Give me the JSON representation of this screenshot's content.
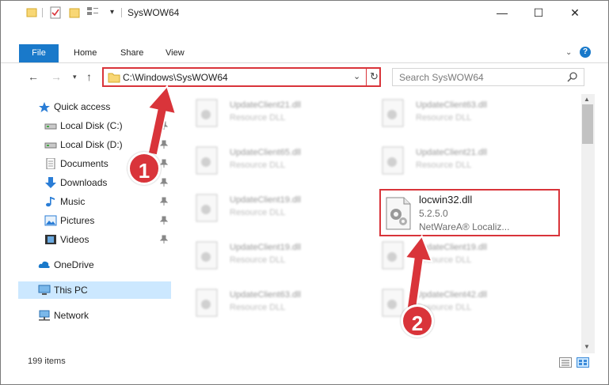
{
  "window": {
    "title": "SysWOW64"
  },
  "controls": {
    "minimize": "—",
    "maximize": "☐",
    "close": "✕"
  },
  "ribbon": {
    "file": "File",
    "home": "Home",
    "share": "Share",
    "view": "View",
    "help": "?"
  },
  "address": {
    "path": "C:\\Windows\\SysWOW64"
  },
  "search": {
    "placeholder": "Search SysWOW64"
  },
  "nav": {
    "quick_access": "Quick access",
    "local_c": "Local Disk (C:)",
    "local_d": "Local Disk (D:)",
    "documents": "Documents",
    "downloads": "Downloads",
    "music": "Music",
    "pictures": "Pictures",
    "videos": "Videos",
    "onedrive": "OneDrive",
    "this_pc": "This PC",
    "network": "Network"
  },
  "files": [
    {
      "name": "UpdateClient21.dll",
      "type": "Resource DLL"
    },
    {
      "name": "UpdateClient63.dll",
      "type": "Resource DLL"
    },
    {
      "name": "UpdateClient65.dll",
      "type": "Resource DLL"
    },
    {
      "name": "UpdateClient21.dll",
      "type": "Resource DLL"
    },
    {
      "name": "UpdateClient19.dll",
      "type": "Resource DLL"
    },
    {
      "name": "UpdateClient19.dll",
      "type": "Resource DLL"
    },
    {
      "name": "UpdateClient19.dll",
      "type": "Resource DLL"
    },
    {
      "name": "UpdateClient63.dll",
      "type": "Resource DLL"
    },
    {
      "name": "UpdateClient42.dll",
      "type": "Resource DLL"
    }
  ],
  "highlighted_file": {
    "name": "locwin32.dll",
    "version": "5.2.5.0",
    "description": "NetWareA® Localiz..."
  },
  "status": {
    "count": "199 items"
  },
  "annotations": {
    "step1": "1",
    "step2": "2"
  },
  "colors": {
    "accent": "#1979ca",
    "highlight": "#d9343a",
    "selection": "#cce8ff"
  }
}
